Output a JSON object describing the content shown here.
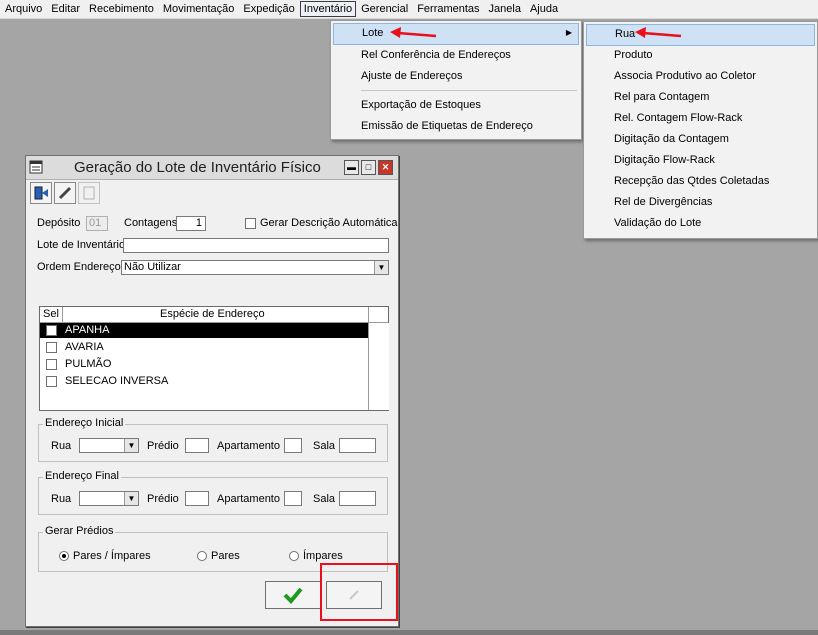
{
  "menubar": [
    "Arquivo",
    "Editar",
    "Recebimento",
    "Movimentação",
    "Expedição",
    "Inventário",
    "Gerencial",
    "Ferramentas",
    "Janela",
    "Ajuda"
  ],
  "inventario_menu": {
    "items": [
      "Lote",
      "Rel Conferência de Endereços",
      "Ajuste de Endereços",
      "Exportação de Estoques",
      "Emissão de Etiquetas de Endereço"
    ]
  },
  "lote_submenu": {
    "items": [
      "Rua",
      "Produto",
      "Associa Produtivo ao Coletor",
      "Rel para Contagem",
      "Rel. Contagem Flow-Rack",
      "Digitação da Contagem",
      "Digitação Flow-Rack",
      "Recepção das Qtdes Coletadas",
      "Rel de Divergências",
      "Validação do Lote"
    ]
  },
  "window": {
    "title": "Geração do Lote de Inventário Físico",
    "deposito_label": "Depósito",
    "deposito_value": "01",
    "contagens_label": "Contagens",
    "contagens_value": "1",
    "gerar_desc_label": "Gerar Descrição Automática",
    "lote_label": "Lote de Inventário",
    "lote_value": "",
    "ordem_label": "Ordem Endereços",
    "ordem_value": "Não Utilizar",
    "grid": {
      "col_sel": "Sel",
      "col_especie": "Espécie de Endereço",
      "rows": [
        "APANHA",
        "AVARIA",
        "PULMÃO",
        "SELECAO INVERSA"
      ]
    },
    "inicial": {
      "title": "Endereço Inicial",
      "rua": "Rua",
      "predio": "Prédio",
      "apartamento": "Apartamento",
      "sala": "Sala"
    },
    "final": {
      "title": "Endereço Final",
      "rua": "Rua",
      "predio": "Prédio",
      "apartamento": "Apartamento",
      "sala": "Sala"
    },
    "gerar": {
      "title": "Gerar Prédios",
      "opt1": "Pares / Ímpares",
      "opt2": "Pares",
      "opt3": "Ímpares",
      "selected": "Pares / Ímpares"
    }
  },
  "colors": {
    "highlight": "#cfe1f5",
    "annotation": "#e8101a",
    "ok_green": "#1f9a1f"
  }
}
